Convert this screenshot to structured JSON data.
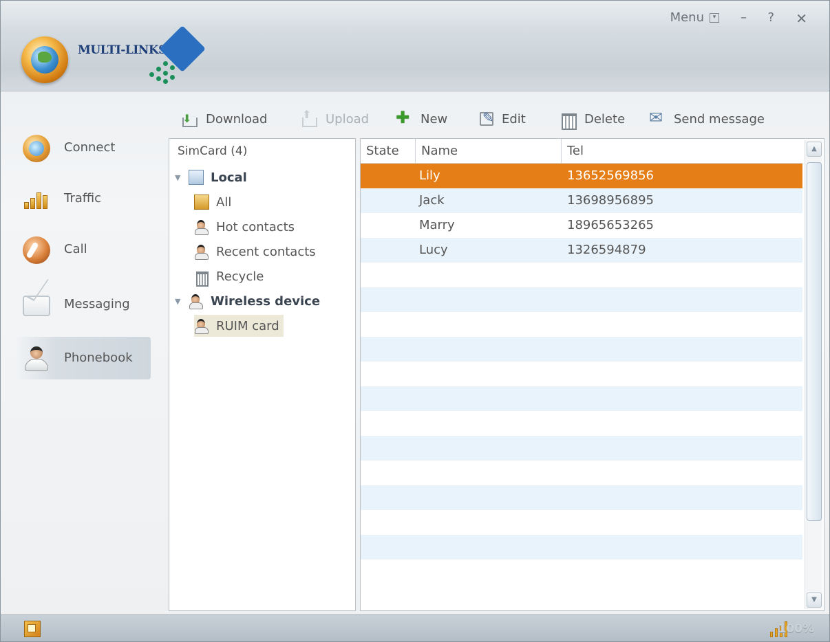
{
  "header": {
    "brand": "MULTI-LINKS",
    "menu_label": "Menu",
    "minimize_glyph": "–",
    "help_glyph": "?",
    "close_glyph": "✕"
  },
  "sidebar": {
    "items": [
      {
        "label": "Connect",
        "icon": "globe-icon"
      },
      {
        "label": "Traffic",
        "icon": "bar-chart-icon"
      },
      {
        "label": "Call",
        "icon": "phone-icon"
      },
      {
        "label": "Messaging",
        "icon": "envelope-icon"
      },
      {
        "label": "Phonebook",
        "icon": "person-icon",
        "active": true
      }
    ]
  },
  "toolbar": {
    "download": "Download",
    "upload": "Upload",
    "new": "New",
    "edit": "Edit",
    "delete": "Delete",
    "send_message": "Send message"
  },
  "tree": {
    "header": "SimCard (4)",
    "local": "Local",
    "all": "All",
    "hot_contacts": "Hot contacts",
    "recent_contacts": "Recent contacts",
    "recycle": "Recycle",
    "wireless_device": "Wireless device",
    "ruim_card": "RUIM card"
  },
  "list": {
    "columns": [
      "State",
      "Name",
      "Tel"
    ],
    "rows": [
      {
        "state": "",
        "name": "Lily",
        "tel": "13652569856",
        "selected": true
      },
      {
        "state": "",
        "name": "Jack",
        "tel": "13698956895"
      },
      {
        "state": "",
        "name": "Marry",
        "tel": "18965653265"
      },
      {
        "state": "",
        "name": "Lucy",
        "tel": "1326594879"
      }
    ],
    "empty_rows": 13
  },
  "status": {
    "signal_text": "100%"
  },
  "colors": {
    "selection": "#e67e17",
    "row_alt": "#e9f3fb"
  }
}
